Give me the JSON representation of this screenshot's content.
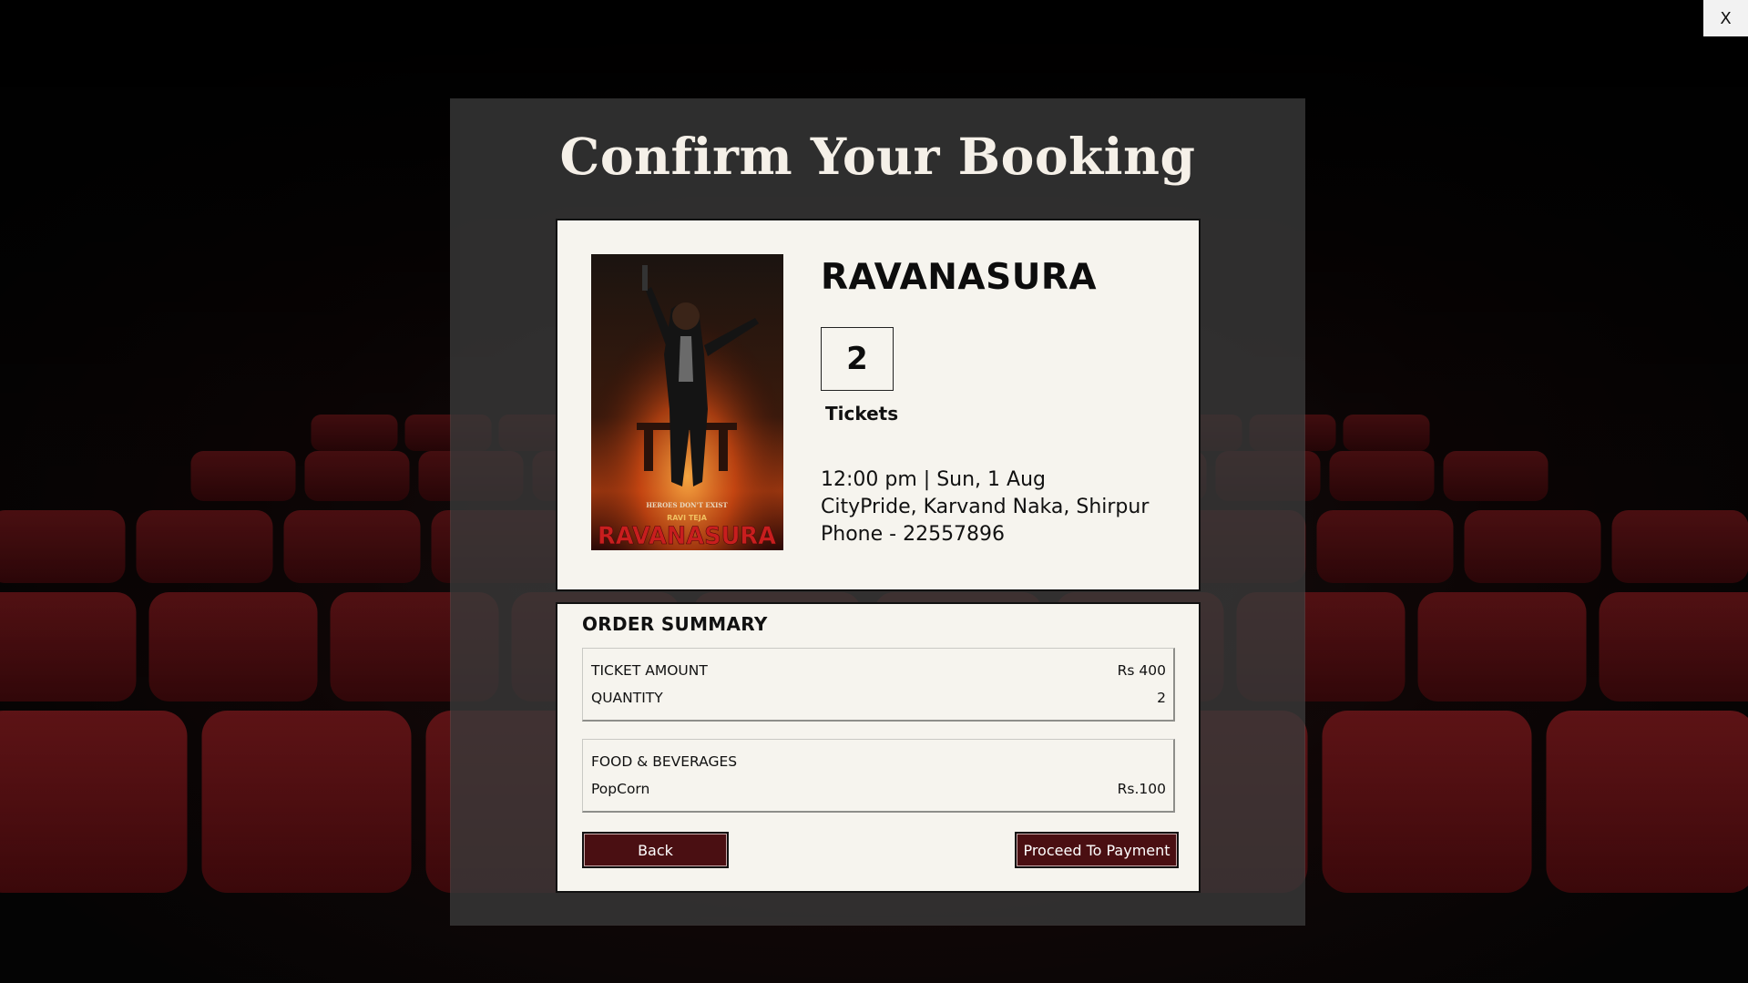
{
  "window": {
    "close_label": "X"
  },
  "dialog": {
    "title": "Confirm Your Booking"
  },
  "movie": {
    "title": "RAVANASURA",
    "ticket_count": "2",
    "ticket_label": "Tickets",
    "showtime": "12:00 pm | Sun, 1 Aug",
    "venue": "CityPride, Karvand Naka, Shirpur",
    "phone": "Phone - 22557896",
    "poster": {
      "tagline": "HEROES DON'T EXIST",
      "actor": "RAVI TEJA",
      "title": "RAVANASURA"
    }
  },
  "summary": {
    "heading": "ORDER SUMMARY",
    "ticket_amount_label": "TICKET AMOUNT",
    "ticket_amount_value": "Rs 400",
    "quantity_label": "QUANTITY",
    "quantity_value": "2",
    "food_heading": "FOOD & BEVERAGES",
    "food_item_label": "PopCorn",
    "food_item_value": "Rs.100"
  },
  "buttons": {
    "back": "Back",
    "pay": "Proceed To Payment"
  },
  "colors": {
    "button_bg": "#4a0f12",
    "card_bg": "#f6f4ee",
    "seat_red": "#7a1418"
  }
}
